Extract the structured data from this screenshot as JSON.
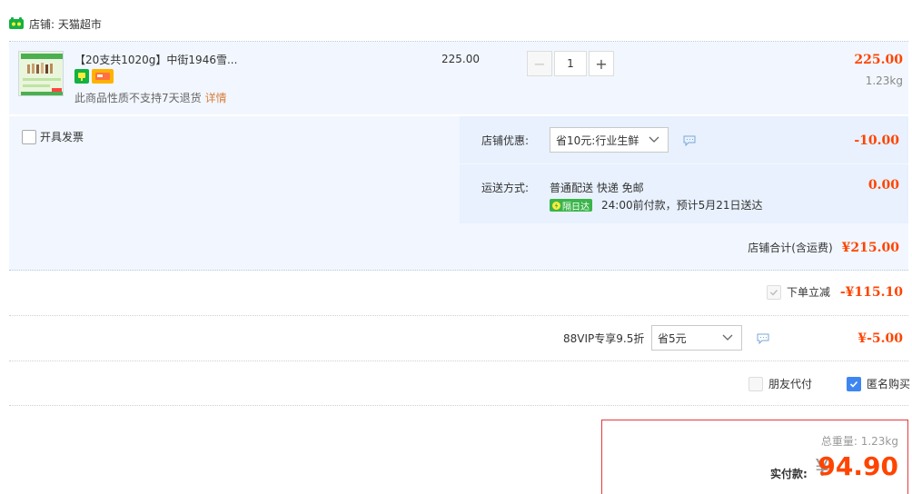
{
  "store": {
    "label": "店铺: 天猫超市",
    "accent": "#13b243"
  },
  "item": {
    "title": "【20支共1020g】中街1946雪...",
    "unit_price": "225.00",
    "quantity": "1",
    "line_total": "225.00",
    "weight": "1.23kg",
    "no_return_text": "此商品性质不支持7天退货",
    "detail_link": "详情",
    "badges": [
      "tmall-badge-icon",
      "card-badge-icon"
    ]
  },
  "options": {
    "invoice_label": "开具发票",
    "store_discount": {
      "label": "店铺优惠:",
      "selected": "省10元:行业生鲜",
      "amount": "-10.00"
    },
    "shipping": {
      "label": "运送方式:",
      "method": "普通配送 快递 免邮",
      "fee": "0.00",
      "next_day_badge": "隔日达",
      "deliver_note": "24:00前付款，预计5月21日送达"
    },
    "store_total": {
      "label": "店铺合计(含运费)",
      "amount": "¥215.00"
    }
  },
  "order_discount": {
    "label": "下单立减",
    "amount": "-¥115.10"
  },
  "vip": {
    "label": "88VIP专享9.5折",
    "selected": "省5元",
    "amount": "¥-5.00"
  },
  "checkout_options": {
    "friend_pay": "朋友代付",
    "anonymous": "匿名购买"
  },
  "summary": {
    "weight": "总重量: 1.23kg",
    "pay_label": "实付款:",
    "currency": "¥",
    "pay_amount": "94.90"
  },
  "colors": {
    "price_red": "#ff4400",
    "panel_bg": "#f2f7ff",
    "checkbox_blue": "#3d86f2"
  }
}
